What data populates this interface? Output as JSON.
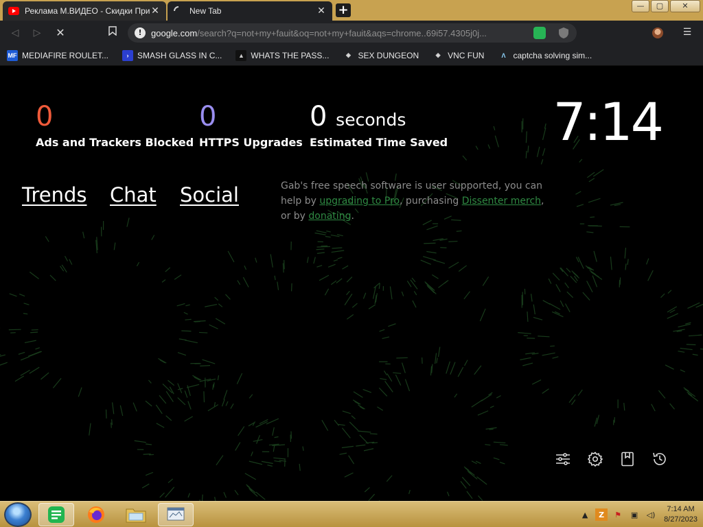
{
  "browser": {
    "tabs": [
      {
        "title": "Реклама М.ВИДЕО - Скидки При",
        "favicon": "youtube-icon",
        "active": false
      },
      {
        "title": "New Tab",
        "favicon": "loading-spinner-icon",
        "active": true
      }
    ],
    "new_tab_label": "+",
    "address": {
      "domain": "google.com",
      "rest": "/search?q=not+my+fauit&oq=not+my+fauit&aqs=chrome..69i57.4305j0j..."
    },
    "window_buttons": {
      "minimize": "—",
      "maximize": "▢",
      "close": "✕"
    },
    "bookmarks": [
      {
        "label": "MEDIAFIRE ROULET...",
        "icon": "mediafire-icon"
      },
      {
        "label": "SMASH GLASS IN C...",
        "icon": "chevron-icon"
      },
      {
        "label": "WHATS THE PASS...",
        "icon": "lock-icon"
      },
      {
        "label": "SEX DUNGEON",
        "icon": "cube-icon"
      },
      {
        "label": "VNC FUN",
        "icon": "cube-icon"
      },
      {
        "label": "captcha solving sim...",
        "icon": "peak-icon"
      }
    ]
  },
  "stats": [
    {
      "value": "0",
      "unit": "",
      "label": "Ads and Trackers Blocked",
      "color": "#ef5a3a"
    },
    {
      "value": "0",
      "unit": "",
      "label": "HTTPS Upgrades",
      "color": "#9a8ef0"
    },
    {
      "value": "0",
      "unit": "seconds",
      "label": "Estimated Time Saved",
      "color": "#ffffff"
    }
  ],
  "clock": "7:14",
  "links": [
    "Trends",
    "Chat",
    "Social"
  ],
  "note": {
    "part1": "Gab's free speech software is user supported, you can help by ",
    "link1": "upgrading to Pro",
    "part2": ", purchasing ",
    "link2": "Dissenter merch",
    "part3": ", or by ",
    "link3": "donating",
    "part4": "."
  },
  "taskbar": {
    "time": "7:14 AM",
    "date": "8/27/2023"
  },
  "colors": {
    "accent_green": "#2f8a43",
    "titlebar": "#c8a250"
  }
}
